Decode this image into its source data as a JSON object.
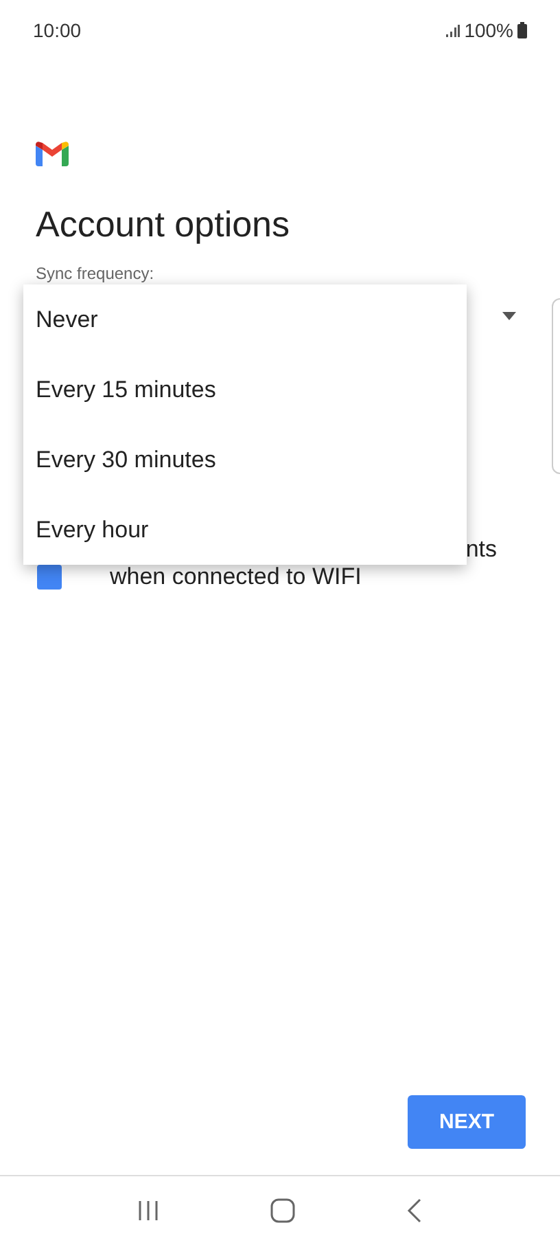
{
  "status_bar": {
    "time": "10:00",
    "battery": "100%"
  },
  "title": "Account options",
  "sync_frequency": {
    "label": "Sync frequency:"
  },
  "background_option": {
    "checked": true,
    "visible_line_end": "nts",
    "second_line": "when connected to WIFI"
  },
  "menu": {
    "items": [
      {
        "label": "Never",
        "selected": false
      },
      {
        "label": "Every 15 minutes",
        "selected": false
      },
      {
        "label": "Every 30 minutes",
        "selected": false
      },
      {
        "label": "Every hour",
        "selected": false
      }
    ]
  },
  "next_button": "NEXT"
}
